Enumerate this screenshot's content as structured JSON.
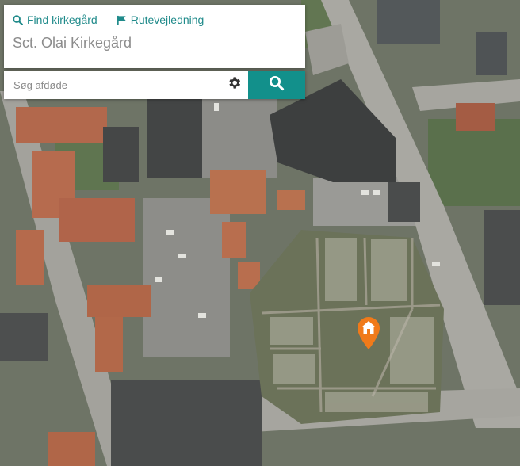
{
  "header": {
    "find_cemetery_label": "Find kirkegård",
    "route_label": "Rutevejledning",
    "cemetery_name": "Sct. Olai Kirkegård"
  },
  "search": {
    "placeholder": "Søg afdøde",
    "value": ""
  },
  "icons": {
    "find": "search-icon",
    "route": "flag-icon",
    "settings": "gear-icon",
    "search_button": "search-icon",
    "marker": "home-map-marker-icon"
  },
  "colors": {
    "accent": "#12908b",
    "marker": "#f07a1a"
  }
}
